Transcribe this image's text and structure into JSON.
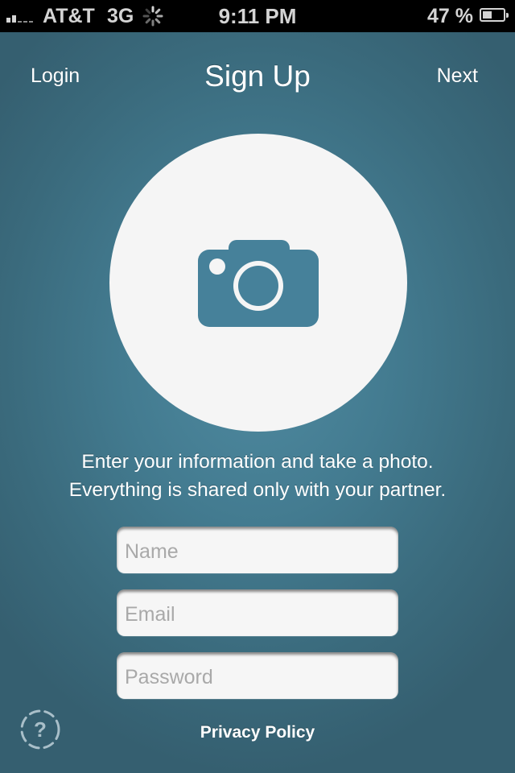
{
  "status_bar": {
    "carrier": "AT&T",
    "network": "3G",
    "time": "9:11 PM",
    "battery_percent_label": "47 %",
    "battery_level": 0.47,
    "signal_bars": 2,
    "signal_bars_total": 5,
    "activity_icon": "spinner-icon"
  },
  "nav": {
    "left_label": "Login",
    "title": "Sign Up",
    "right_label": "Next"
  },
  "photo": {
    "icon": "camera-icon",
    "accent_color": "#46819a",
    "circle_color": "#f5f5f5"
  },
  "description": {
    "line1": "Enter your information and take a photo.",
    "line2": "Everything is shared only with your partner."
  },
  "form": {
    "name": {
      "placeholder": "Name",
      "value": ""
    },
    "email": {
      "placeholder": "Email",
      "value": ""
    },
    "password": {
      "placeholder": "Password",
      "value": ""
    }
  },
  "footer": {
    "help_icon": "help-icon",
    "privacy_label": "Privacy Policy"
  },
  "colors": {
    "background": "#437b90",
    "status_bar": "#000000",
    "text": "#ffffff"
  }
}
